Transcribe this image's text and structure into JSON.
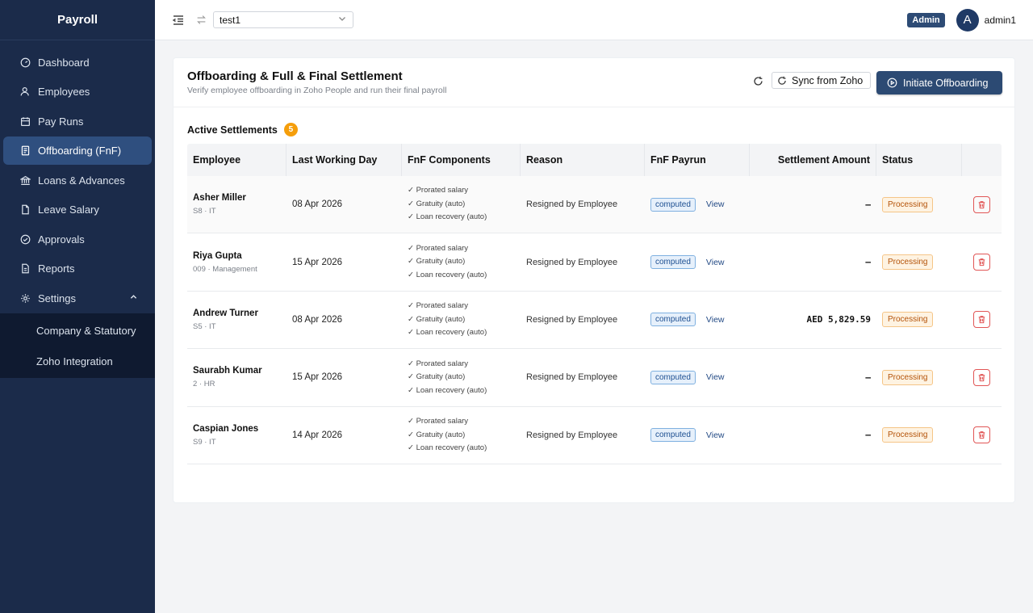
{
  "app": {
    "title": "Payroll"
  },
  "sidebar": {
    "items": [
      {
        "label": "Dashboard",
        "icon": "dashboard-icon"
      },
      {
        "label": "Employees",
        "icon": "users-icon"
      },
      {
        "label": "Pay Runs",
        "icon": "calendar-icon"
      },
      {
        "label": "Offboarding (FnF)",
        "icon": "document-icon",
        "active": true
      },
      {
        "label": "Loans & Advances",
        "icon": "bank-icon"
      },
      {
        "label": "Leave Salary",
        "icon": "file-icon"
      },
      {
        "label": "Approvals",
        "icon": "check-circle-icon"
      },
      {
        "label": "Reports",
        "icon": "report-icon"
      },
      {
        "label": "Settings",
        "icon": "gear-icon",
        "expanded": true
      }
    ],
    "settings_children": [
      "Company & Statutory",
      "Zoho Integration"
    ]
  },
  "topbar": {
    "org_value": "test1",
    "role": "Admin",
    "avatar_initial": "A",
    "username": "admin1"
  },
  "page": {
    "title": "Offboarding & Full & Final Settlement",
    "subtitle": "Verify employee offboarding in Zoho People and run their final payroll",
    "sync_label": "Sync from Zoho",
    "initiate_label": "Initiate Offboarding",
    "section_title": "Active Settlements",
    "count": "5"
  },
  "table": {
    "headers": [
      "Employee",
      "Last Working Day",
      "FnF Components",
      "Reason",
      "FnF Payrun",
      "Settlement Amount",
      "Status",
      ""
    ],
    "rows": [
      {
        "name": "Asher Miller",
        "meta": "S8 · IT",
        "lwd": "08 Apr 2026",
        "components": [
          "✓ Prorated salary",
          "✓ Gratuity (auto)",
          "✓ Loan recovery (auto)"
        ],
        "reason": "Resigned by Employee",
        "payrun": "computed",
        "view": "View",
        "amount": "–",
        "status": "Processing"
      },
      {
        "name": "Riya Gupta",
        "meta": "009 · Management",
        "lwd": "15 Apr 2026",
        "components": [
          "✓ Prorated salary",
          "✓ Gratuity (auto)",
          "✓ Loan recovery (auto)"
        ],
        "reason": "Resigned by Employee",
        "payrun": "computed",
        "view": "View",
        "amount": "–",
        "status": "Processing"
      },
      {
        "name": "Andrew Turner",
        "meta": "S5 · IT",
        "lwd": "08 Apr 2026",
        "components": [
          "✓ Prorated salary",
          "✓ Gratuity (auto)",
          "✓ Loan recovery (auto)"
        ],
        "reason": "Resigned by Employee",
        "payrun": "computed",
        "view": "View",
        "amount": "AED 5,829.59",
        "status": "Processing"
      },
      {
        "name": "Saurabh Kumar",
        "meta": "2 · HR",
        "lwd": "15 Apr 2026",
        "components": [
          "✓ Prorated salary",
          "✓ Gratuity (auto)",
          "✓ Loan recovery (auto)"
        ],
        "reason": "Resigned by Employee",
        "payrun": "computed",
        "view": "View",
        "amount": "–",
        "status": "Processing"
      },
      {
        "name": "Caspian Jones",
        "meta": "S9 · IT",
        "lwd": "14 Apr 2026",
        "components": [
          "✓ Prorated salary",
          "✓ Gratuity (auto)",
          "✓ Loan recovery (auto)"
        ],
        "reason": "Resigned by Employee",
        "payrun": "computed",
        "view": "View",
        "amount": "–",
        "status": "Processing"
      }
    ]
  },
  "colors": {
    "sidebar": "#1b2b4a",
    "active": "#2f4f7f",
    "primary": "#2c4a73",
    "badge": "#f59e0b",
    "danger": "#e15656"
  }
}
